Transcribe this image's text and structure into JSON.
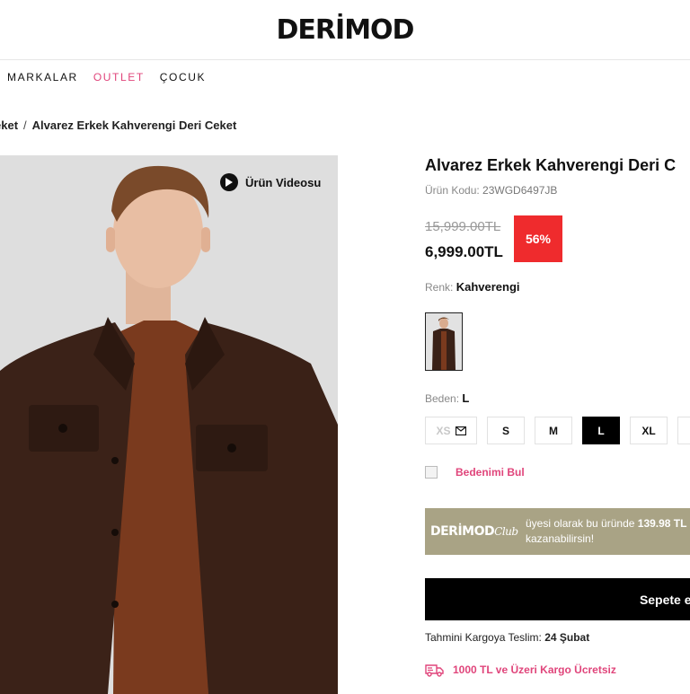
{
  "brand": {
    "logo_text": "DERİMOD"
  },
  "nav": {
    "items": [
      "MARKALAR",
      "OUTLET",
      "ÇOCUK"
    ]
  },
  "breadcrumb": {
    "parent": "eket",
    "separator": "/",
    "current": "Alvarez Erkek Kahverengi Deri Ceket"
  },
  "gallery": {
    "video_label": "Ürün Videosu"
  },
  "product": {
    "title": "Alvarez Erkek Kahverengi Deri C",
    "code_label": "Ürün Kodu:",
    "code_value": "23WGD6497JB",
    "old_price": "15,999.00TL",
    "new_price": "6,999.00TL",
    "discount": "56%",
    "color_label": "Renk:",
    "color_value": "Kahverengi",
    "size_label": "Beden:",
    "size_value": "L",
    "sizes": [
      "XS",
      "S",
      "M",
      "L",
      "XL"
    ],
    "find_size": "Bedenimi Bul"
  },
  "club": {
    "logo_main": "DERİMOD",
    "logo_script": "Club",
    "text_part1": "üyesi olarak bu üründe",
    "points": "139.98 TL",
    "text_part2": "kazanabilirsin!"
  },
  "cart": {
    "button_label": "Sepete ekle"
  },
  "delivery": {
    "label": "Tahmini Kargoya Teslim:",
    "date": "24 Şubat"
  },
  "shipping": {
    "text": "1000 TL ve Üzeri Kargo Ücretsiz"
  },
  "colors": {
    "accent_pink": "#e0457b",
    "discount_red": "#ef2b2d",
    "club_bg": "#a9a385"
  }
}
